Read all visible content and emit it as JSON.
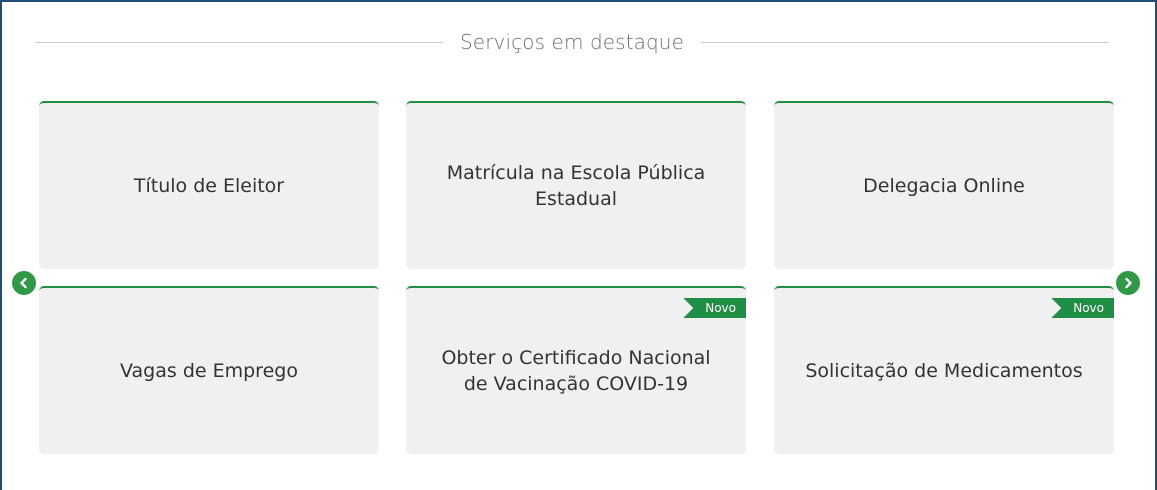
{
  "section": {
    "title": "Serviços em destaque"
  },
  "services": [
    {
      "title": "Título de Eleitor",
      "badge": ""
    },
    {
      "title": "Matrícula na Escola Pública Estadual",
      "badge": ""
    },
    {
      "title": "Delegacia Online",
      "badge": ""
    },
    {
      "title": "Vagas de Emprego",
      "badge": ""
    },
    {
      "title": "Obter o Certificado Nacional de Vacinação COVID-19",
      "badge": "Novo"
    },
    {
      "title": "Solicitação de Medicamentos",
      "badge": "Novo"
    }
  ],
  "carousel": {
    "prev_icon": "chevron-left-icon",
    "next_icon": "chevron-right-icon"
  },
  "colors": {
    "accent": "#1e8f45",
    "card_background": "#f0f0f0",
    "frame_border": "#1f4e79",
    "title_text": "#6e6e6e"
  }
}
